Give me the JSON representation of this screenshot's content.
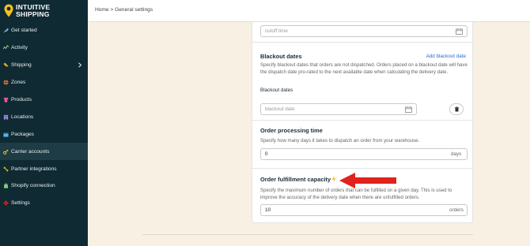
{
  "brand": {
    "line1": "INTUITIVE",
    "line2": "SHIPPING"
  },
  "sidebar": {
    "items": [
      {
        "label": "Get started",
        "icon": "rocket-icon"
      },
      {
        "label": "Activity",
        "icon": "activity-icon"
      },
      {
        "label": "Shipping",
        "icon": "shipping-icon"
      },
      {
        "label": "Zones",
        "icon": "globe-icon"
      },
      {
        "label": "Products",
        "icon": "shirt-icon"
      },
      {
        "label": "Locations",
        "icon": "building-icon"
      },
      {
        "label": "Packages",
        "icon": "package-icon"
      },
      {
        "label": "Carrier accounts",
        "icon": "key-icon"
      },
      {
        "label": "Partner integrations",
        "icon": "plug-icon"
      },
      {
        "label": "Shopify connection",
        "icon": "shopify-icon"
      },
      {
        "label": "Settings",
        "icon": "gear-icon"
      }
    ],
    "active": "Carrier accounts"
  },
  "breadcrumb": "Home > General settings",
  "cutoff": {
    "placeholder": "cutoff time"
  },
  "blackout": {
    "title": "Blackout dates",
    "link": "Add blackout date",
    "description": "Specify blackout dates that orders are not dispatched. Orders placed on a blackout date will have the dispatch date pro-rated to the next available date when calculating the delivery date.",
    "sub_label": "Blackout dates",
    "placeholder": "blackout date"
  },
  "processing": {
    "title": "Order processing time",
    "description": "Specify how many days it takes to dispatch an order from your warehouse.",
    "value": "0",
    "suffix": "days"
  },
  "capacity": {
    "title": "Order fulfillment capacity",
    "description": "Specify the maximum number of orders that can be fulfilled on a given day. This is used to improve the accuracy of the delivery date when there are unfulfilled orders.",
    "value": "10",
    "suffix": "orders"
  },
  "colors": {
    "sidebar_bg": "#0f2a33",
    "page_bg": "#f7f0e3",
    "link": "#2a6ad1",
    "arrow": "#e0231c",
    "brand_yellow": "#f5c21b"
  }
}
